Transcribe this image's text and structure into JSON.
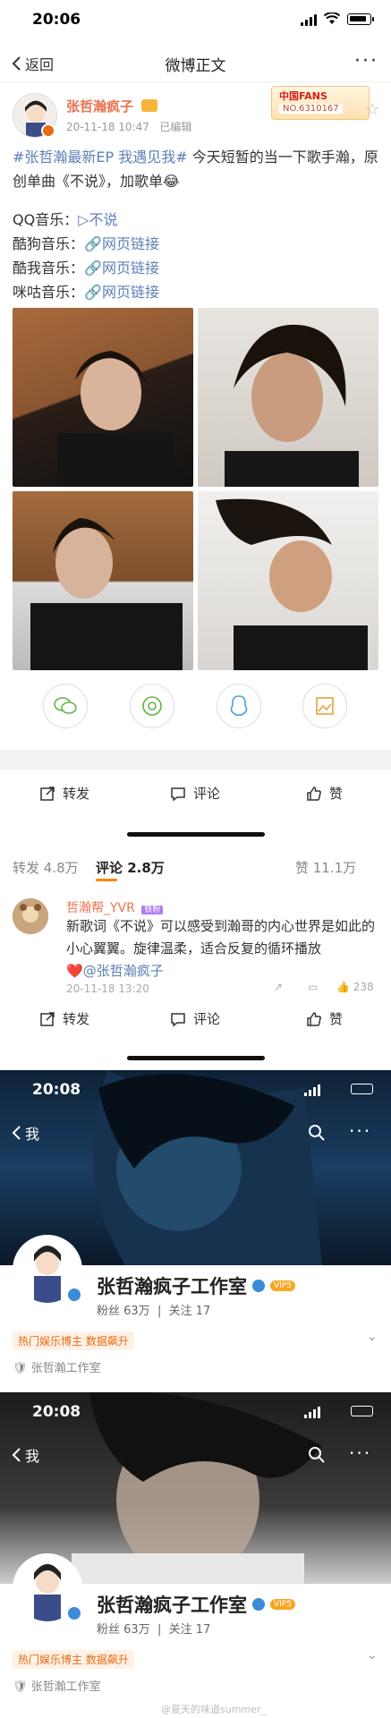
{
  "status_bar": {
    "time": "20:06"
  },
  "nav": {
    "back_label": "返回",
    "title": "微博正文",
    "more": "···"
  },
  "post": {
    "author": "张哲瀚疯子",
    "date": "20-11-18 10:47",
    "edited": "已编辑",
    "fans_badge_title": "中国FANS",
    "fans_badge_no": "NO.6310167",
    "hashtag": "#张哲瀚最新EP 我遇见我#",
    "text": "今天短暂的当一下歌手瀚，原创单曲《不说》，加歌单",
    "emoji": "😂",
    "qq_label": "QQ音乐：",
    "qq_link": "不说",
    "kugou_label": "酷狗音乐：",
    "kuwo_label": "酷我音乐：",
    "migu_label": "咪咕音乐：",
    "web_link": "网页链接"
  },
  "actions": {
    "repost": "转发",
    "comment": "评论",
    "like": "赞"
  },
  "tabs": {
    "reposts": "转发 4.8万",
    "comments": "评论 2.8万",
    "likes": "赞 11.1万"
  },
  "comment": {
    "name": "哲瀚帮_YVR",
    "tag": "铁粉",
    "text": "新歌词《不说》可以感受到瀚哥的内心世界是如此的小心翼翼。旋律温柔，适合反复的循环播放",
    "heart": "❤️",
    "mention": "@张哲瀚疯子",
    "date": "20-11-18 13:20",
    "likes": "238"
  },
  "profile1": {
    "time": "20:08",
    "back": "我",
    "name": "张哲瀚疯子工作室",
    "fans": "粉丝 63万",
    "follow": "关注 17",
    "badge": "热门娱乐博主 数据飙升",
    "verify": "张哲瀚工作室",
    "vip": "VIP5"
  },
  "profile2": {
    "time": "20:08",
    "back": "我",
    "name": "张哲瀚疯子工作室",
    "fans": "粉丝 63万",
    "follow": "关注 17",
    "badge": "热门娱乐博主 数据飙升",
    "verify": "张哲瀚工作室",
    "vip": "VIP5"
  },
  "watermark": "@夏天的味道summer_"
}
